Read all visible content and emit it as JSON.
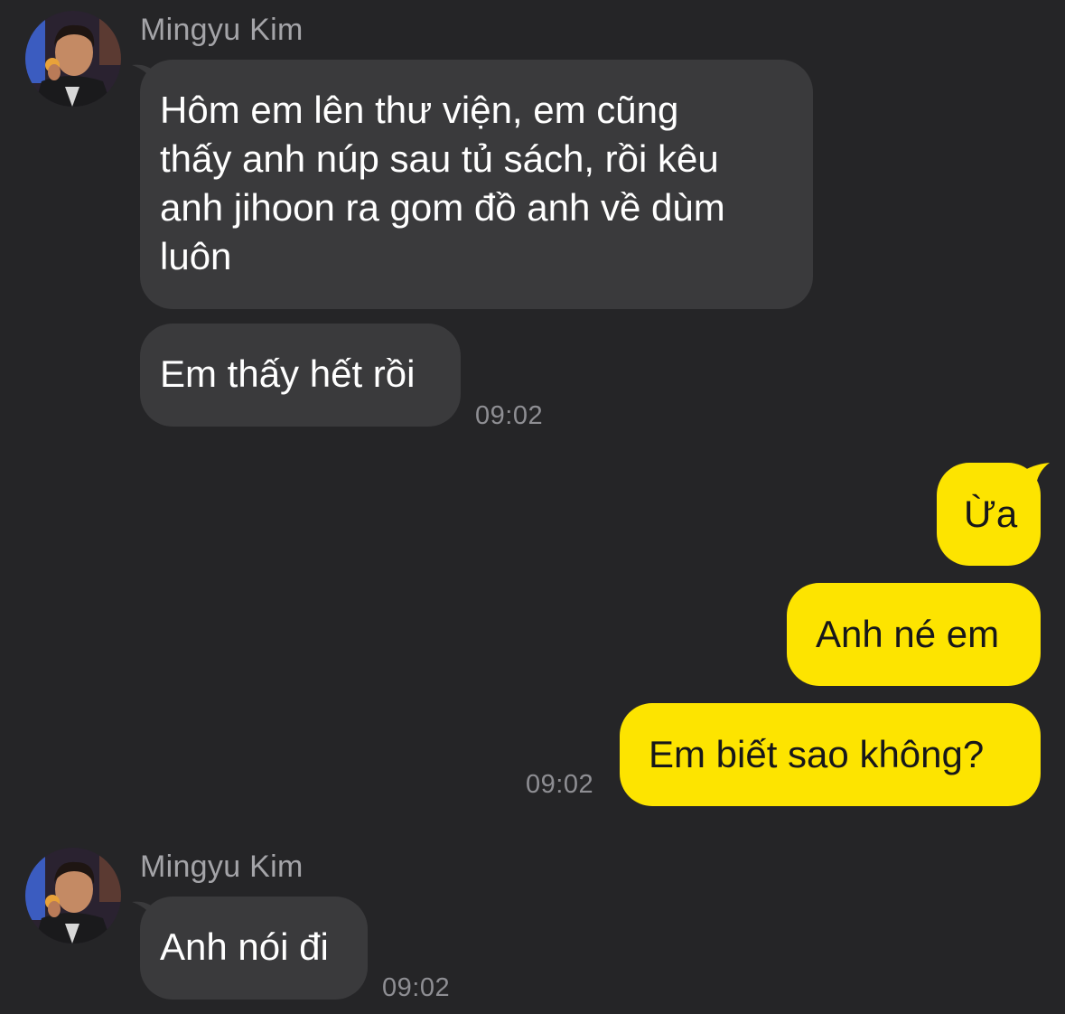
{
  "colors": {
    "background": "#252527",
    "incoming_bubble": "#3a3a3c",
    "outgoing_bubble": "#fde400",
    "timestamp": "#8e8e93",
    "sender_name": "#a4a4a8"
  },
  "groups": [
    {
      "sender": "Mingyu Kim",
      "avatar_icon": "profile-photo",
      "messages": [
        "Hôm em lên thư viện, em cũng\nthấy anh núp sau tủ sách, rồi kêu\nanh jihoon ra gom đồ anh về dùm\nluôn",
        "Em thấy hết rồi"
      ],
      "time": "09:02"
    },
    {
      "sender": "me",
      "messages": [
        "Ừa",
        "Anh né em",
        "Em biết sao không?"
      ],
      "time": "09:02"
    },
    {
      "sender": "Mingyu Kim",
      "avatar_icon": "profile-photo",
      "messages": [
        "Anh nói đi"
      ],
      "time": "09:02"
    }
  ]
}
